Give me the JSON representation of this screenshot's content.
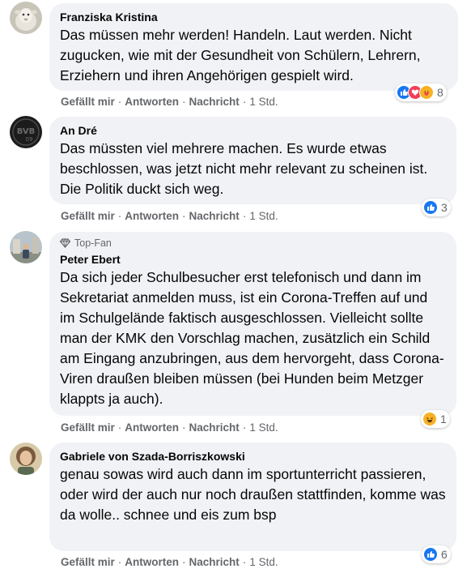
{
  "comments": [
    {
      "author": "Franziska Kristina",
      "text": "Das müssen mehr werden! Handeln. Laut werden. Nicht zugucken, wie mit der Gesundheit von Schülern, Lehrern, Erziehern und ihren Angehörigen gespielt wird.",
      "reaction_count": "8",
      "reactions": [
        "like-icon",
        "love-icon",
        "care-icon"
      ]
    },
    {
      "author": "An Dré",
      "text": "Das müssten viel mehrere machen. Es wurde etwas beschlossen, was jetzt nicht mehr relevant zu scheinen ist. Die Politik duckt sich weg.",
      "reaction_count": "3",
      "reactions": [
        "like-icon"
      ]
    },
    {
      "badge": "Top-Fan",
      "author": "Peter Ebert",
      "text": "Da sich jeder Schulbesucher erst telefonisch und dann im Sekretariat anmelden muss, ist ein Corona-Treffen auf und im Schulgelände faktisch ausgeschlossen. Vielleicht sollte man der KMK den Vorschlag machen, zusätzlich ein Schild am Eingang anzubringen, aus dem hervorgeht, dass Corona-Viren draußen bleiben müssen (bei Hunden beim Metzger klappts ja auch).",
      "reaction_count": "1",
      "reactions": [
        "haha-icon"
      ]
    },
    {
      "author": "Gabriele von Szada-Borriszkowski",
      "text": "genau sowas wird auch dann im sportunterricht passieren, oder wird der auch nur noch draußen stattfinden, komme was da wolle.. schnee und eis zum bsp",
      "reaction_count": "6",
      "reactions": [
        "like-icon"
      ]
    }
  ],
  "actions": {
    "like": "Gefällt mir",
    "reply": "Antworten",
    "message": "Nachricht",
    "time": "1 Std.",
    "separator": "·"
  },
  "colors": {
    "bubble": "#f0f2f5",
    "meta_text": "#65676b",
    "like": "#1877f2",
    "love": "#f33e58",
    "care": "#f7b125"
  }
}
